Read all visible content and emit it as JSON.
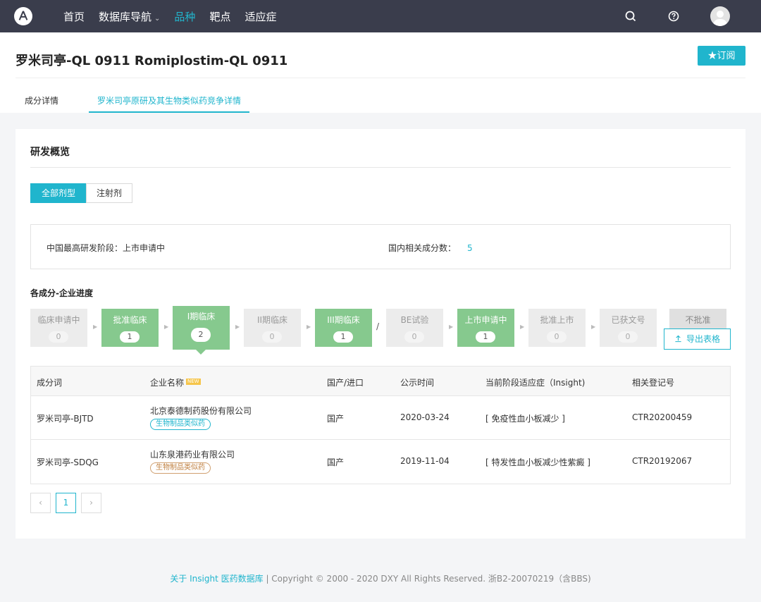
{
  "nav": {
    "items": [
      {
        "label": "首页",
        "active": false
      },
      {
        "label": "数据库导航",
        "active": false,
        "caret": "⌄"
      },
      {
        "label": "品种",
        "active": true
      },
      {
        "label": "靶点",
        "active": false
      },
      {
        "label": "适应症",
        "active": false
      }
    ],
    "icons": [
      "search-icon",
      "help-icon",
      "user-avatar-icon"
    ]
  },
  "header": {
    "title": "罗米司亭-QL 0911 Romiplostim-QL 0911",
    "subscribe_label": "★订阅",
    "tabs": [
      {
        "label": "成分详情",
        "active": false
      },
      {
        "label": "罗米司亭原研及其生物类似药竞争详情",
        "active": true
      }
    ]
  },
  "card": {
    "title": "研发概览",
    "segments": [
      {
        "label": "全部剂型",
        "active": true
      },
      {
        "label": "注射剂",
        "active": false
      }
    ],
    "summary": {
      "stage_label": "中国最高研发阶段：上市申请中",
      "count_label": "国内相关成分数：",
      "count_value": "5"
    },
    "progress_title": "各成分-企业进度",
    "stages": [
      {
        "label": "临床申请中",
        "count": "0",
        "active": false
      },
      {
        "label": "批准临床",
        "count": "1",
        "active": true
      },
      {
        "label": "I期临床",
        "count": "2",
        "active": true
      },
      {
        "label": "II期临床",
        "count": "0",
        "active": false
      },
      {
        "label": "III期临床",
        "count": "1",
        "active": true
      },
      {
        "label": "BE试验",
        "count": "0",
        "active": false
      },
      {
        "label": "上市申请中",
        "count": "1",
        "active": true
      },
      {
        "label": "批准上市",
        "count": "0",
        "active": false
      },
      {
        "label": "已获文号",
        "count": "0",
        "active": false
      },
      {
        "label": "不批准",
        "count": "",
        "active": false
      }
    ],
    "slash": "/",
    "export_label": "导出表格",
    "table": {
      "headers": [
        "成分词",
        "企业名称",
        "国产/进口",
        "公示时间",
        "当前阶段适应症（Insight)",
        "相关登记号"
      ],
      "new_badge": "NEW",
      "rows": [
        {
          "ingredient": "罗米司亭-BJTD",
          "company": "北京泰德制药股份有限公司",
          "tag": "生物制品类似药",
          "tag_color": "#20b5cd",
          "origin": "国产",
          "date": "2020-03-24",
          "indication": "[ 免疫性血小板减少 ]",
          "reg_no": "CTR20200459"
        },
        {
          "ingredient": "罗米司亭-SDQG",
          "company": "山东泉港药业有限公司",
          "tag": "生物制品类似药",
          "tag_color": "#c08040",
          "origin": "国产",
          "date": "2019-11-04",
          "indication": "[ 特发性血小板减少性紫癜 ]",
          "reg_no": "CTR20192067"
        }
      ]
    },
    "pager": {
      "prev": "‹",
      "current": "1",
      "next": "›"
    }
  },
  "footer": {
    "link": "关于 Insight 医药数据库",
    "text": "| Copyright © 2000 - 2020 DXY All Rights Reserved. 浙B2-20070219（含BBS)"
  },
  "colors": {
    "accent": "#20b5cd",
    "nav_bg": "#3a3d4c",
    "stage_on": "#86c98e"
  }
}
